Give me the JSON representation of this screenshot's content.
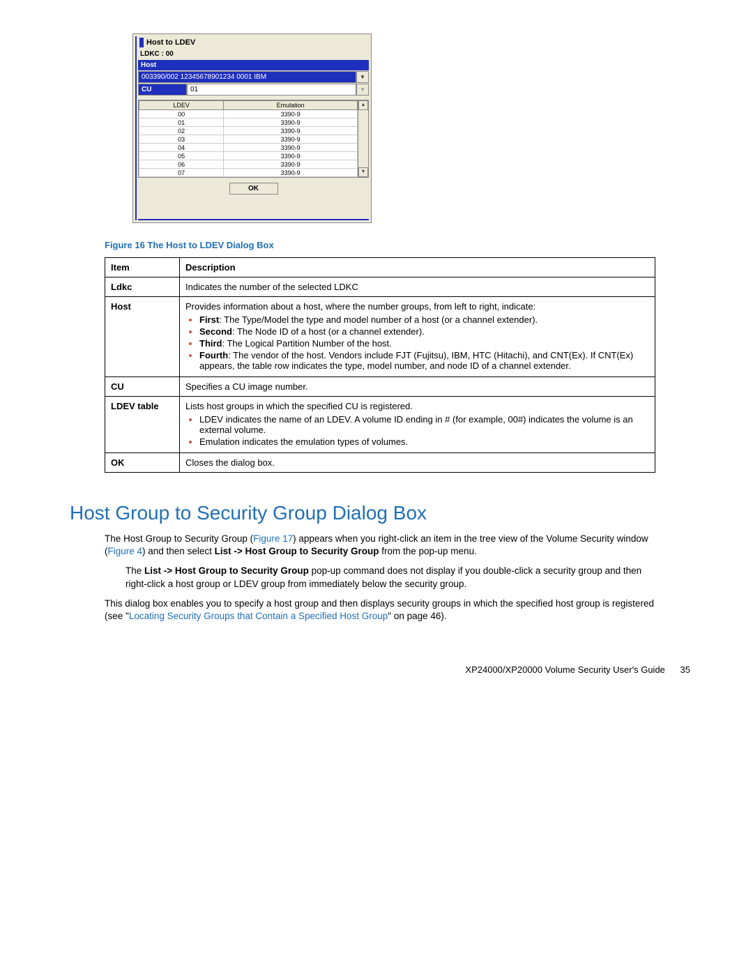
{
  "dialog": {
    "title": "Host to LDEV",
    "ldkc_label": "LDKC : 00",
    "host_header": "Host",
    "host_value": "003390/002  12345678901234  0001   IBM",
    "cu_header": "CU",
    "cu_value": "01",
    "table": {
      "col1": "LDEV",
      "col2": "Emulation",
      "rows": [
        {
          "ldev": "00",
          "emul": "3390-9"
        },
        {
          "ldev": "01",
          "emul": "3390-9"
        },
        {
          "ldev": "02",
          "emul": "3390-9"
        },
        {
          "ldev": "03",
          "emul": "3390-9"
        },
        {
          "ldev": "04",
          "emul": "3390-9"
        },
        {
          "ldev": "05",
          "emul": "3390-9"
        },
        {
          "ldev": "06",
          "emul": "3390-9"
        },
        {
          "ldev": "07",
          "emul": "3390-9"
        }
      ]
    },
    "ok_label": "OK"
  },
  "figure_caption": "Figure 16 The Host to LDEV Dialog Box",
  "desc_table": {
    "header_item": "Item",
    "header_desc": "Description",
    "rows": {
      "ldkc_item": "Ldkc",
      "ldkc_desc": "Indicates the number of the selected LDKC",
      "host_item": "Host",
      "host_intro": "Provides information about a host, where the number groups, from left to right, indicate:",
      "host_first_label": "First",
      "host_first_rest": ": The Type/Model the type and model number of a host (or a channel extender).",
      "host_second_label": "Second",
      "host_second_rest": ": The Node ID of a host (or a channel extender).",
      "host_third_label": "Third",
      "host_third_rest": ": The Logical Partition Number of the host.",
      "host_fourth_label": "Fourth",
      "host_fourth_rest": ": The vendor of the host. Vendors include FJT (Fujitsu), IBM, HTC (Hitachi), and CNT(Ex). If CNT(Ex) appears, the table row indicates the type, model number, and node ID of a channel extender.",
      "cu_item": "CU",
      "cu_desc": "Specifies a CU image number.",
      "ldev_item_prefix": "LDEV",
      "ldev_item_suffix": " table",
      "ldev_intro": "Lists host groups in which the specified CU is registered.",
      "ldev_b1": "LDEV indicates the name of an LDEV. A volume ID ending in # (for example, 00#) indicates the volume is an external volume.",
      "ldev_b2": "Emulation indicates the emulation types of volumes.",
      "ok_item": "OK",
      "ok_desc": "Closes the dialog box."
    }
  },
  "section_heading": "Host Group to Security Group Dialog Box",
  "para1_pre": "The Host Group to Security Group (",
  "para1_link1": "Figure 17",
  "para1_mid1": ") appears when you right-click an item in the tree view of the Volume Security window (",
  "para1_link2": "Figure 4",
  "para1_mid2": ") and then select ",
  "para1_bold": "List -> Host Group to Security Group",
  "para1_end": " from the pop-up menu.",
  "para2_pre": "The ",
  "para2_bold": "List -> Host Group to Security Group",
  "para2_end": " pop-up command does not display if you double-click a security group and then right-click a host group or LDEV group from immediately below the security group.",
  "para3_pre": "This dialog box enables you to specify a host group and then displays security groups in which the specified host group is registered (see \"",
  "para3_link": "Locating Security Groups that Contain a Specified Host Group",
  "para3_end": "\" on page 46).",
  "footer_title": "XP24000/XP20000 Volume Security User's Guide",
  "footer_page": "35"
}
